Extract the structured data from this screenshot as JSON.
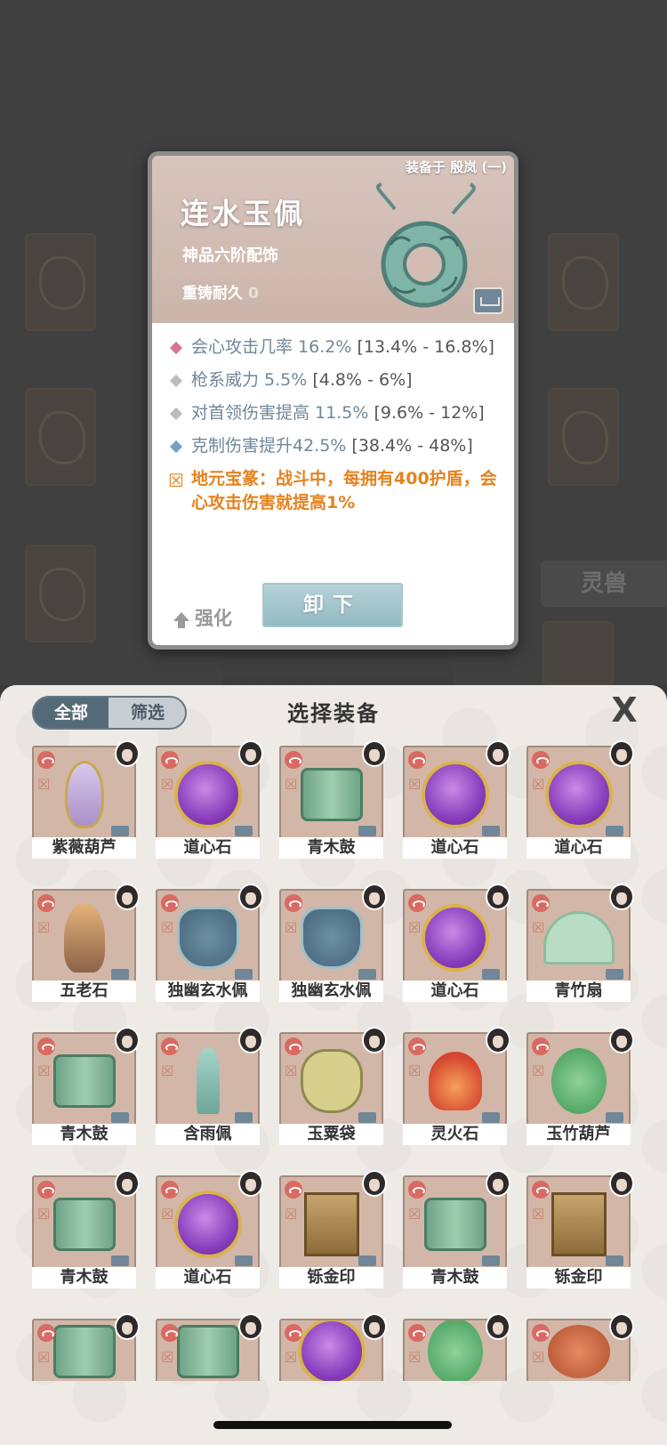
{
  "background": {
    "pet_tab_label": "灵兽"
  },
  "detail_card": {
    "equipped_on": "装备于 殷岚 (一)",
    "item_name": "连水玉佩",
    "grade": "神品六阶配饰",
    "reforge_label": "重铸耐久",
    "reforge_value": "0",
    "stats": [
      {
        "text": "会心攻击几率 16.2% ",
        "range": "[13.4% - 16.8%]",
        "color": "#d9739a"
      },
      {
        "text": "枪系威力 5.5% ",
        "range": "[4.8% - 6%]",
        "color": "#bdbdbd"
      },
      {
        "text": "对首领伤害提高 11.5% ",
        "range": "[9.6% - 12%]",
        "color": "#bdbdbd"
      },
      {
        "text": "克制伤害提升42.5% ",
        "range": "[38.4% - 48%]",
        "color": "#6fa3c7"
      }
    ],
    "special_effect": "地元宝篆：战斗中，每拥有400护盾，会心攻击伤害就提高1%",
    "enhance_label": "强化",
    "unequip_label": "卸下"
  },
  "panel": {
    "filter_all": "全部",
    "filter_select": "筛选",
    "title": "选择装备",
    "close": "X",
    "items": [
      {
        "name": "紫薇葫芦",
        "art": "gourd"
      },
      {
        "name": "道心石",
        "art": "orb"
      },
      {
        "name": "青木鼓",
        "art": "drum"
      },
      {
        "name": "道心石",
        "art": "orb"
      },
      {
        "name": "道心石",
        "art": "orb"
      },
      {
        "name": "五老石",
        "art": "stone"
      },
      {
        "name": "独幽玄水佩",
        "art": "pendant"
      },
      {
        "name": "独幽玄水佩",
        "art": "pendant"
      },
      {
        "name": "道心石",
        "art": "orb"
      },
      {
        "name": "青竹扇",
        "art": "fan"
      },
      {
        "name": "青木鼓",
        "art": "drum"
      },
      {
        "name": "含雨佩",
        "art": "tassel"
      },
      {
        "name": "玉粟袋",
        "art": "bag"
      },
      {
        "name": "灵火石",
        "art": "fire"
      },
      {
        "name": "玉竹葫芦",
        "art": "green-gourd"
      },
      {
        "name": "青木鼓",
        "art": "drum"
      },
      {
        "name": "道心石",
        "art": "orb"
      },
      {
        "name": "铄金印",
        "art": "seal"
      },
      {
        "name": "青木鼓",
        "art": "drum"
      },
      {
        "name": "铄金印",
        "art": "seal"
      }
    ],
    "partial_row": [
      {
        "art": "drum"
      },
      {
        "art": "drum"
      },
      {
        "art": "orb"
      },
      {
        "art": "green-gourd"
      },
      {
        "art": "shell"
      }
    ]
  }
}
